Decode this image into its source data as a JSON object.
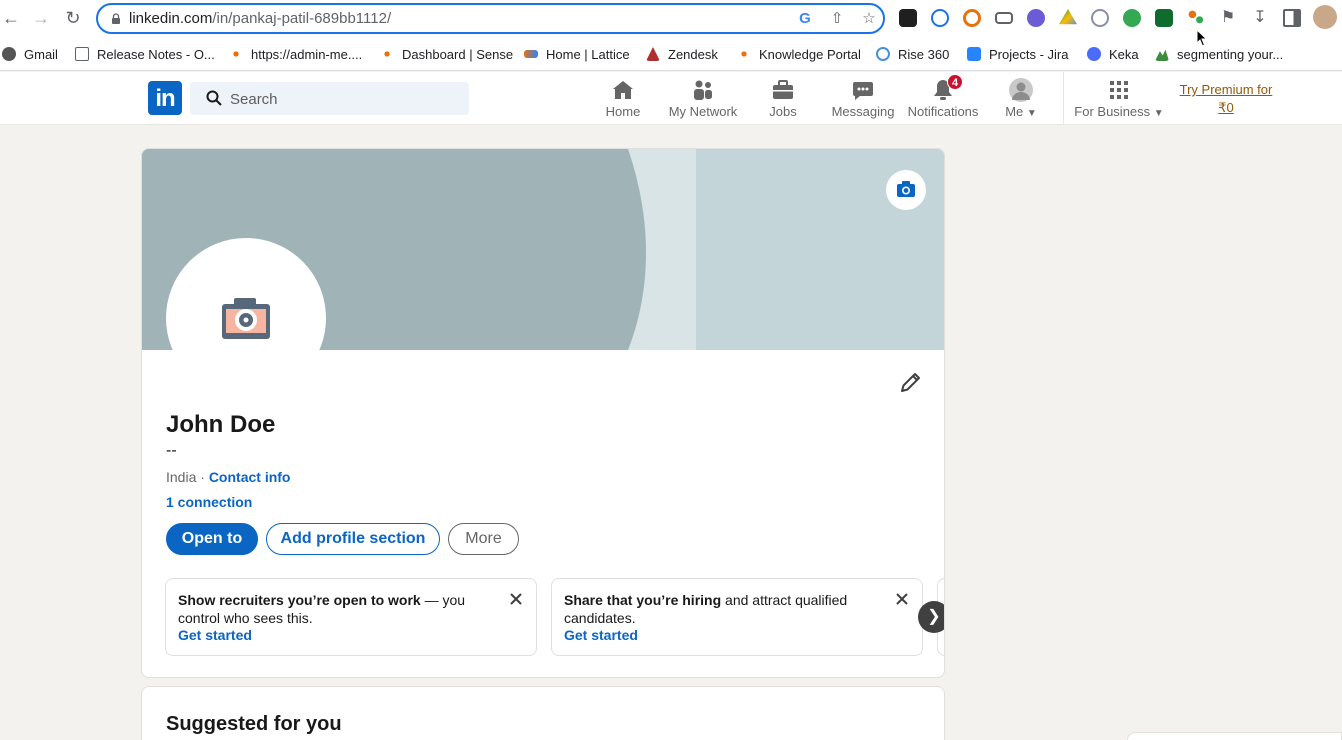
{
  "browser": {
    "url_host": "linkedin.com",
    "url_path": "/in/pankaj-patil-689bb1112/",
    "bookmarks": [
      {
        "label": "Gmail",
        "icon": "gmail-icon",
        "color": "#555555"
      },
      {
        "label": "Release Notes - O...",
        "icon": "folder-icon",
        "color": "#5f6368"
      },
      {
        "label": "https://admin-me....",
        "icon": "dots-icon",
        "color": "#e8710a"
      },
      {
        "label": "Dashboard | Sense",
        "icon": "dots-icon",
        "color": "#e8710a"
      },
      {
        "label": "Home | Lattice",
        "icon": "lattice-icon",
        "color": "#e8710a"
      },
      {
        "label": "Zendesk",
        "icon": "zendesk-icon",
        "color": "#b03030"
      },
      {
        "label": "Knowledge Portal",
        "icon": "dots-icon",
        "color": "#e8710a"
      },
      {
        "label": "Rise 360",
        "icon": "rise-icon",
        "color": "#4a90d9"
      },
      {
        "label": "Projects - Jira",
        "icon": "jira-icon",
        "color": "#2684ff"
      },
      {
        "label": "Keka",
        "icon": "keka-icon",
        "color": "#4b6bfb"
      },
      {
        "label": "segmenting your...",
        "icon": "mountain-icon",
        "color": "#3c8c3c"
      }
    ]
  },
  "header": {
    "logo": "in",
    "search_placeholder": "Search",
    "nav": [
      {
        "label": "Home",
        "icon": "home-icon"
      },
      {
        "label": "My Network",
        "icon": "network-icon"
      },
      {
        "label": "Jobs",
        "icon": "jobs-icon"
      },
      {
        "label": "Messaging",
        "icon": "messaging-icon"
      },
      {
        "label": "Notifications",
        "icon": "bell-icon",
        "badge": "4"
      },
      {
        "label": "Me",
        "icon": "avatar-icon"
      },
      {
        "label": "For Business",
        "icon": "grid-icon"
      }
    ],
    "premium_line1": "Try Premium for",
    "premium_line2": "₹0"
  },
  "profile": {
    "name": "John Doe",
    "headline": "--",
    "location": "India",
    "contact_info": "Contact info",
    "connections": "1 connection",
    "buttons": {
      "open_to": "Open to",
      "add_section": "Add profile section",
      "more": "More"
    },
    "promos": [
      {
        "bold": "Show recruiters you’re open to work",
        "rest": " — you control who sees this.",
        "link": "Get started"
      },
      {
        "bold": "Share that you’re hiring",
        "rest": " and attract qualified candidates.",
        "link": "Get started"
      }
    ]
  },
  "suggested": {
    "title": "Suggested for you"
  },
  "colors": {
    "brand": "#0a66c2",
    "badge": "#cb112d",
    "banner": "#c3d5d8",
    "premium": "#915907"
  }
}
